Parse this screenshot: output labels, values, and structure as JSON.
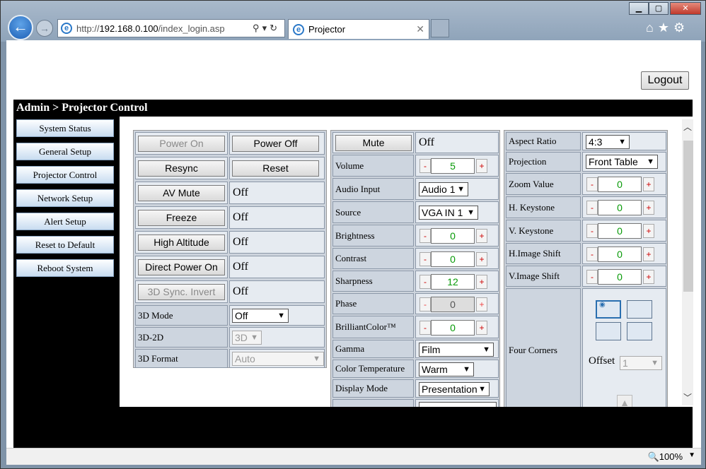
{
  "browser": {
    "url_prefix": "http://",
    "url_host": "192.168.0.100",
    "url_path": "/index_login.asp",
    "tab_title": "Projector",
    "zoom": "100%"
  },
  "page": {
    "logout": "Logout",
    "banner": "Admin > Projector Control"
  },
  "nav": [
    "System Status",
    "General Setup",
    "Projector Control",
    "Network Setup",
    "Alert Setup",
    "Reset to Default",
    "Reboot System"
  ],
  "col1": {
    "power_on": "Power On",
    "power_off": "Power Off",
    "resync": "Resync",
    "reset": "Reset",
    "av_mute": "AV Mute",
    "av_mute_val": "Off",
    "freeze": "Freeze",
    "freeze_val": "Off",
    "high_alt": "High Altitude",
    "high_alt_val": "Off",
    "direct_power": "Direct Power On",
    "direct_power_val": "Off",
    "sync_invert": "3D Sync. Invert",
    "sync_invert_val": "Off",
    "mode_3d": "3D Mode",
    "mode_3d_val": "Off",
    "d2d": "3D-2D",
    "d2d_val": "3D",
    "format_3d": "3D Format",
    "format_3d_val": "Auto"
  },
  "col2": {
    "mute": "Mute",
    "mute_val": "Off",
    "volume": "Volume",
    "volume_val": "5",
    "audio_input": "Audio Input",
    "audio_input_val": "Audio 1",
    "source": "Source",
    "source_val": "VGA IN 1",
    "brightness": "Brightness",
    "brightness_val": "0",
    "contrast": "Contrast",
    "contrast_val": "0",
    "sharpness": "Sharpness",
    "sharpness_val": "12",
    "phase": "Phase",
    "phase_val": "0",
    "brilliant": "BrilliantColor™",
    "brilliant_val": "0",
    "gamma": "Gamma",
    "gamma_val": "Film",
    "color_temp": "Color Temperature",
    "color_temp_val": "Warm",
    "display_mode": "Display Mode",
    "display_mode_val": "Presentation"
  },
  "col3": {
    "aspect": "Aspect Ratio",
    "aspect_val": "4:3",
    "projection": "Projection",
    "projection_val": "Front Table",
    "zoom": "Zoom Value",
    "zoom_val": "0",
    "hkey": "H. Keystone",
    "hkey_val": "0",
    "vkey": "V. Keystone",
    "vkey_val": "0",
    "hshift": "H.Image Shift",
    "hshift_val": "0",
    "vshift": "V.Image Shift",
    "vshift_val": "0",
    "four_corners": "Four Corners",
    "offset": "Offset",
    "offset_val": "1"
  },
  "stepper": {
    "minus": "-",
    "plus": "+"
  }
}
